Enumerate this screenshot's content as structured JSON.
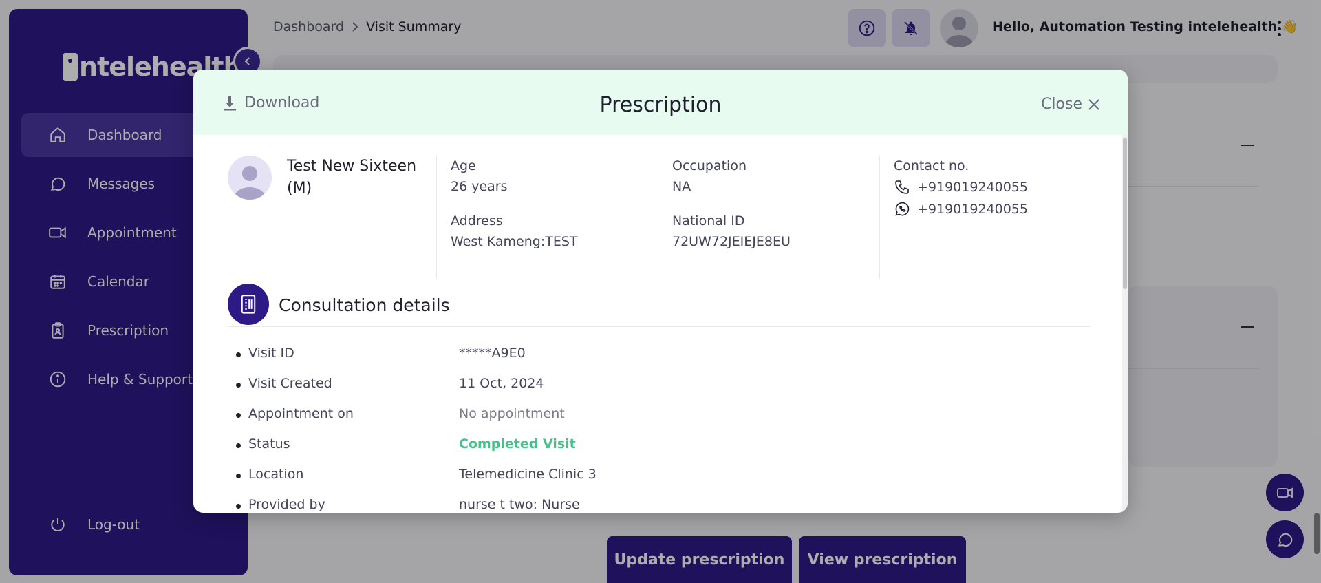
{
  "sidebar": {
    "logo": "intelehealth",
    "items": [
      {
        "label": "Dashboard",
        "icon": "home-icon"
      },
      {
        "label": "Messages",
        "icon": "message-icon"
      },
      {
        "label": "Appointment",
        "icon": "video-icon"
      },
      {
        "label": "Calendar",
        "icon": "calendar-icon"
      },
      {
        "label": "Prescription",
        "icon": "clipboard-icon"
      },
      {
        "label": "Help & Support",
        "icon": "info-icon"
      }
    ],
    "logout": "Log-out"
  },
  "header": {
    "breadcrumb": [
      "Dashboard",
      "Visit Summary"
    ],
    "greeting": "Hello, Automation Testing intelehealth",
    "greeting_emoji": "👋"
  },
  "actions": {
    "update": "Update prescription",
    "view": "View prescription"
  },
  "modal": {
    "download": "Download",
    "title": "Prescription",
    "close": "Close",
    "patient": {
      "name": "Test New Sixteen (M)",
      "age_label": "Age",
      "age": "26 years",
      "address_label": "Address",
      "address": "West Kameng:TEST",
      "occupation_label": "Occupation",
      "occupation": "NA",
      "national_id_label": "National ID",
      "national_id": "72UW72JEIEJE8EU",
      "contact_label": "Contact no.",
      "phone": "+919019240055",
      "whatsapp": "+919019240055"
    },
    "consultation": {
      "title": "Consultation details",
      "rows": [
        {
          "key": "Visit ID",
          "value": "*****A9E0"
        },
        {
          "key": "Visit Created",
          "value": "11 Oct, 2024"
        },
        {
          "key": "Appointment on",
          "value": "No appointment"
        },
        {
          "key": "Status",
          "value": "Completed Visit"
        },
        {
          "key": "Location",
          "value": "Telemedicine Clinic 3"
        },
        {
          "key": "Provided by",
          "value": "nurse t two: Nurse"
        }
      ]
    }
  },
  "colors": {
    "brand": "#2e1a86",
    "status_green": "#44c28a",
    "modal_header": "#e8fbf1"
  }
}
